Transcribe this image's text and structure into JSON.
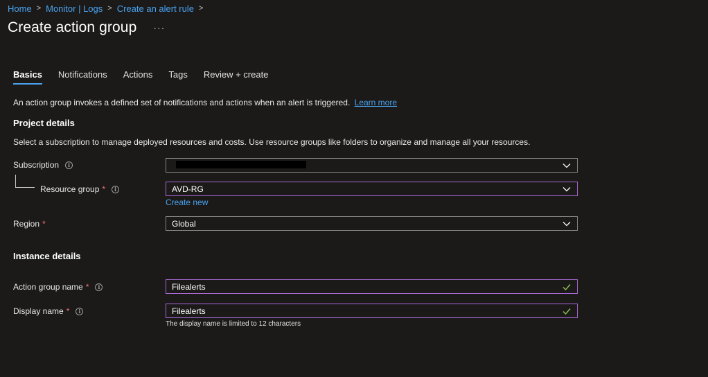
{
  "breadcrumb": {
    "items": [
      "Home",
      "Monitor | Logs",
      "Create an alert rule"
    ],
    "separator": ">"
  },
  "page": {
    "title": "Create action group",
    "more": "···"
  },
  "tabs": [
    {
      "label": "Basics",
      "active": true
    },
    {
      "label": "Notifications"
    },
    {
      "label": "Actions"
    },
    {
      "label": "Tags"
    },
    {
      "label": "Review + create"
    }
  ],
  "intro": {
    "text": "An action group invokes a defined set of notifications and actions when an alert is triggered.",
    "link": "Learn more"
  },
  "project_details": {
    "title": "Project details",
    "description": "Select a subscription to manage deployed resources and costs. Use resource groups like folders to organize and manage all your resources.",
    "subscription_label": "Subscription",
    "subscription_value": "",
    "resource_group_label": "Resource group",
    "resource_group_value": "AVD-RG",
    "create_new": "Create new",
    "region_label": "Region",
    "region_value": "Global"
  },
  "instance_details": {
    "title": "Instance details",
    "action_group_name_label": "Action group name",
    "action_group_name_value": "Filealerts",
    "display_name_label": "Display name",
    "display_name_value": "Filealerts",
    "display_name_hint": "The display name is limited to 12 characters"
  },
  "symbols": {
    "required": "*",
    "info": "i"
  },
  "colors": {
    "accent": "#4aa3f0",
    "focus_border": "#a86ad6",
    "valid_check": "#92c353",
    "required": "#f1707b"
  }
}
